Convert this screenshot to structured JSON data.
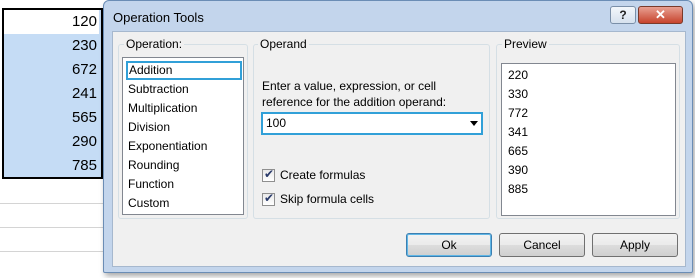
{
  "sheet": {
    "cells": [
      "120",
      "230",
      "672",
      "241",
      "565",
      "290",
      "785"
    ]
  },
  "dialog": {
    "title": "Operation Tools",
    "help_label": "?",
    "close_label": "✕"
  },
  "operation": {
    "label": "Operation:",
    "items": [
      "Addition",
      "Subtraction",
      "Multiplication",
      "Division",
      "Exponentiation",
      "Rounding",
      "Function",
      "Custom"
    ],
    "selected": "Addition"
  },
  "operand": {
    "label": "Operand",
    "prompt": "Enter a value, expression, or cell reference for the addition operand:",
    "value": "100",
    "create_formulas_label": "Create formulas",
    "create_formulas_checked": true,
    "skip_formula_label": "Skip formula cells",
    "skip_formula_checked": true
  },
  "preview": {
    "label": "Preview",
    "items": [
      "220",
      "330",
      "772",
      "341",
      "665",
      "390",
      "885"
    ]
  },
  "buttons": {
    "ok": "Ok",
    "cancel": "Cancel",
    "apply": "Apply"
  },
  "colors": {
    "selection": "#c5dcf5",
    "focus_border": "#31a0d8",
    "dialog_frame": "#c3d5ec",
    "close_button": "#c7432c"
  }
}
